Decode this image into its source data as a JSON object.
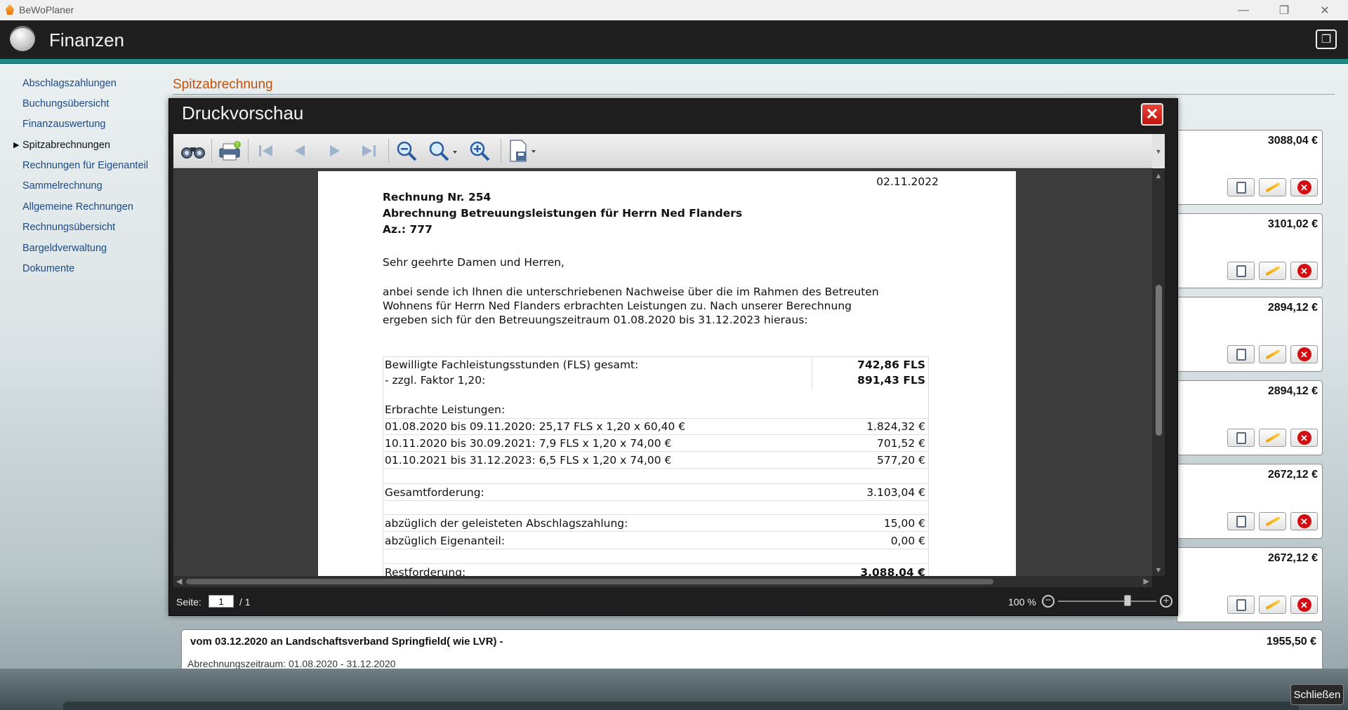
{
  "app": {
    "title": "BeWoPlaner",
    "header": "Finanzen"
  },
  "window_controls": {
    "minimize": "—",
    "maximize": "❐",
    "close": "✕"
  },
  "sidebar": {
    "items": [
      {
        "label": "Abschlagszahlungen",
        "active": false
      },
      {
        "label": "Buchungsübersicht",
        "active": false
      },
      {
        "label": "Finanzauswertung",
        "active": false
      },
      {
        "label": "Spitzabrechnungen",
        "active": true
      },
      {
        "label": "Rechnungen für Eigenanteil",
        "active": false
      },
      {
        "label": "Sammelrechnung",
        "active": false
      },
      {
        "label": "Allgemeine Rechnungen",
        "active": false
      },
      {
        "label": "Rechnungsübersicht",
        "active": false
      },
      {
        "label": "Bargeldverwaltung",
        "active": false
      },
      {
        "label": "Dokumente",
        "active": false
      }
    ]
  },
  "section": {
    "title": "Spitzabrechnung"
  },
  "cards": [
    {
      "amount": "3088,04 €"
    },
    {
      "amount": "3101,02 €"
    },
    {
      "amount": "2894,12 €"
    },
    {
      "amount": "2894,12 €"
    },
    {
      "amount": "2672,12 €"
    },
    {
      "amount": "2672,12 €"
    }
  ],
  "bottom_card": {
    "title": "vom 03.12.2020 an Landschaftsverband Springfield( wie LVR) -",
    "amount": "1955,50 €",
    "subtitle": "Abrechnungszeitraum: 01.08.2020 - 31.12.2020"
  },
  "close_button": "Schließen",
  "dialog": {
    "title": "Druckvorschau",
    "close": "✕",
    "status": {
      "page_label": "Seite:",
      "page_value": "1",
      "page_total": "/ 1",
      "zoom": "100 %",
      "zoom_fraction": 0.72
    },
    "document": {
      "date": "02.11.2022",
      "heading1": "Rechnung Nr. 254",
      "heading2": "Abrechnung Betreuungsleistungen für Herrn Ned Flanders",
      "heading3": "Az.: 777",
      "salutation": "Sehr geehrte Damen und Herren,",
      "body": [
        "anbei sende ich Ihnen die unterschriebenen Nachweise über die im Rahmen des Betreuten",
        "Wohnens für Herrn Ned Flanders erbrachten Leistungen zu. Nach unserer Berechnung",
        "ergeben sich für den Betreuungszeitraum 01.08.2020 bis 31.12.2023 hieraus:"
      ],
      "table": {
        "fls_total_label": "Bewilligte Fachleistungsstunden (FLS) gesamt:",
        "fls_total_value": "742,86 FLS",
        "factor_label": "- zzgl. Faktor 1,20:",
        "factor_value": "891,43 FLS",
        "services_label": "Erbrachte Leistungen:",
        "services": [
          {
            "label": "01.08.2020 bis 09.11.2020: 25,17 FLS x 1,20 x 60,40 €",
            "value": "1.824,32 €"
          },
          {
            "label": "10.11.2020 bis 30.09.2021: 7,9 FLS x 1,20 x 74,00 €",
            "value": "701,52 €"
          },
          {
            "label": "01.10.2021 bis 31.12.2023: 6,5 FLS x 1,20 x 74,00 €",
            "value": "577,20 €"
          }
        ],
        "total_label": "Gesamtforderung:",
        "total_value": "3.103,04 €",
        "deduction_label": "abzüglich der geleisteten Abschlagszahlung:",
        "deduction_value": "15,00 €",
        "own_share_label": "abzüglich Eigenanteil:",
        "own_share_value": "0,00 €",
        "remaining_label": "Restforderung:",
        "remaining_value": "3.088,04 €"
      }
    }
  }
}
